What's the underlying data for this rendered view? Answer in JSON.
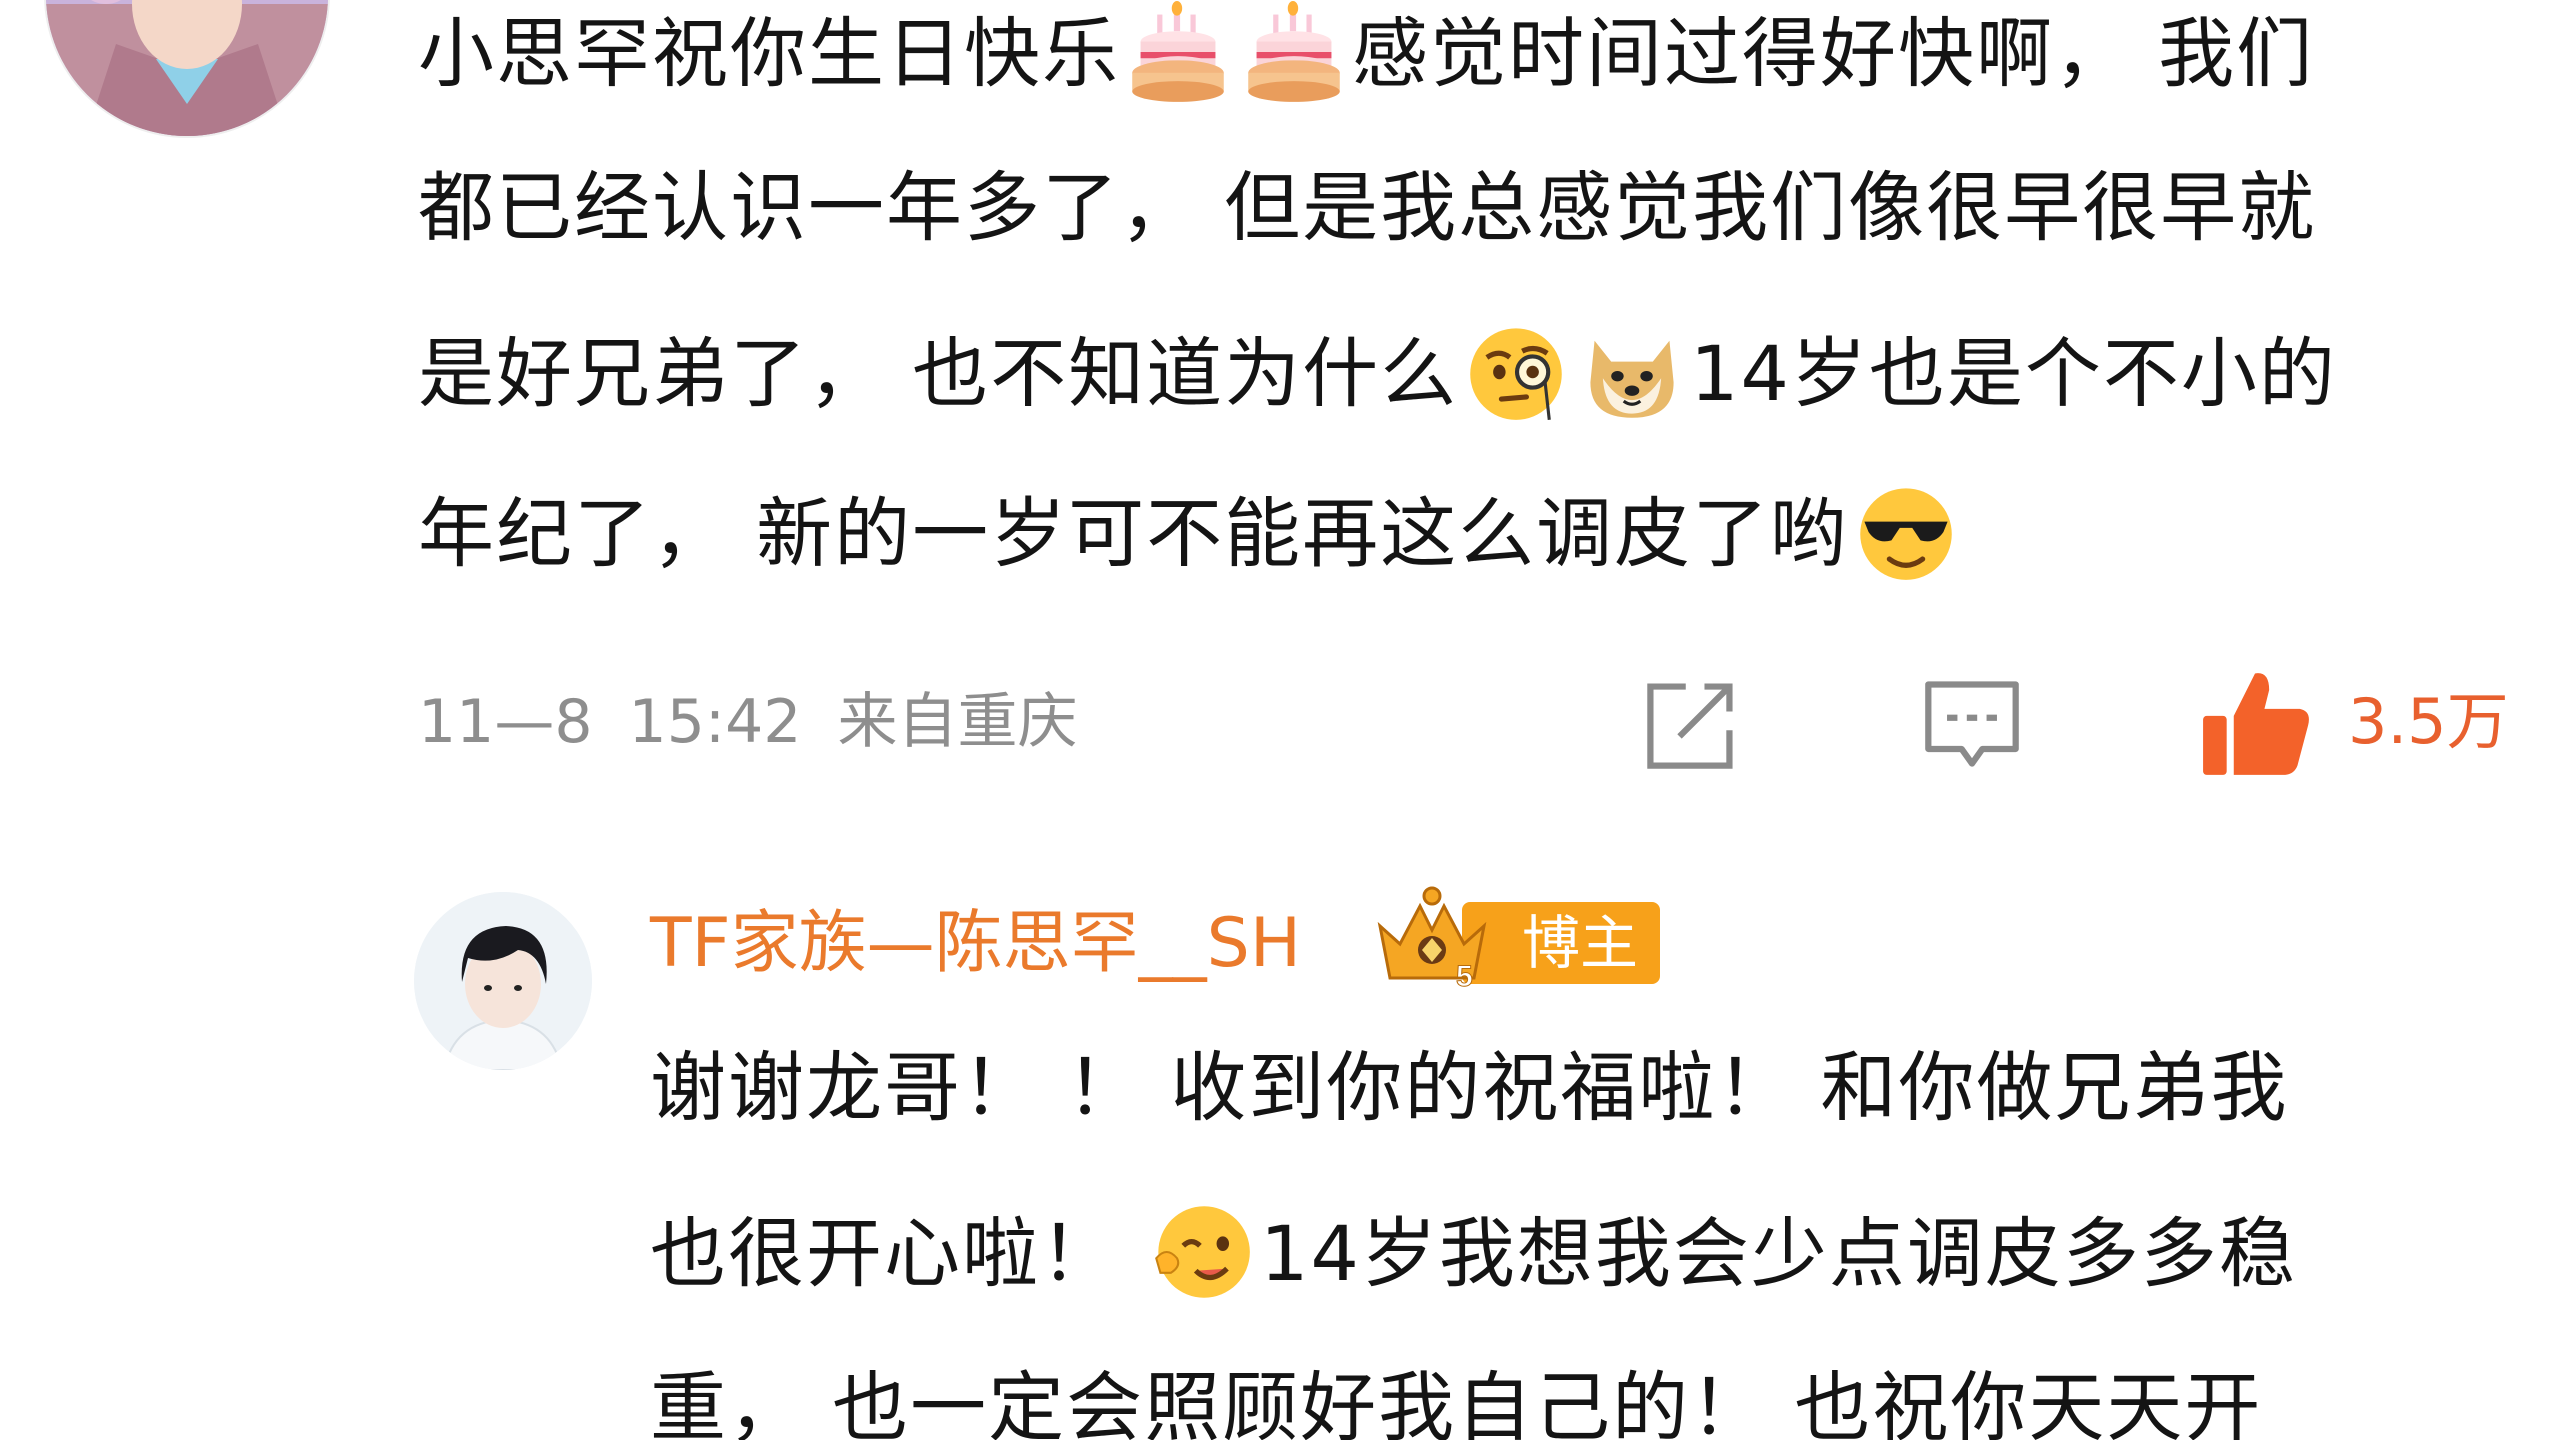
{
  "comment": {
    "lines": [
      {
        "before": "小思罕祝你生日快乐",
        "between": "",
        "after": "感觉时间过得好快啊， 我们"
      },
      {
        "text": "都已经认识一年多了， 但是我总感觉我们像很早很早就"
      },
      {
        "before": "是好兄弟了， 也不知道为什么",
        "after": "14岁也是个不小的"
      },
      {
        "before": "年纪了， 新的一岁可不能再这么调皮了哟",
        "after": ""
      }
    ],
    "emojis": [
      "birthday-cake-icon",
      "birthday-cake-icon",
      "monocle-face-icon",
      "doge-icon",
      "sunglasses-face-icon"
    ],
    "date": "11—8",
    "time": "15:42",
    "location": "来自重庆",
    "likes": "3.5万"
  },
  "reply": {
    "username": "TF家族—陈思罕__SH",
    "badge_level": "5",
    "badge_label": "博主",
    "lines": [
      {
        "text": "谢谢龙哥！ ！ 收到你的祝福啦！ 和你做兄弟我"
      },
      {
        "before": "也很开心啦！ ",
        "after": "14岁我想我会少点调皮多多稳"
      },
      {
        "text": "重， 也一定会照顾好我自己的！ 也祝你天天开"
      }
    ],
    "emojis": [
      "wink-face-icon"
    ]
  },
  "colors": {
    "username": "#ea7a2c",
    "likes": "#e8602e",
    "badge": "#f7a11a",
    "meta": "#8e8e8e"
  }
}
